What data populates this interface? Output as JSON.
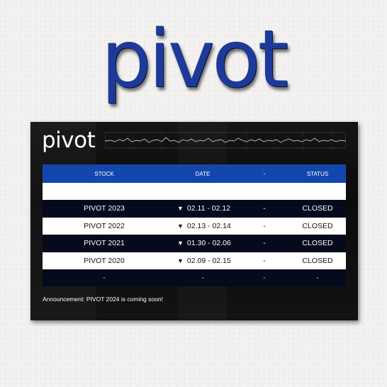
{
  "brand": {
    "logo_text": "pivot",
    "panel_logo_text": "pivot"
  },
  "table": {
    "headers": [
      "STOCK",
      "DATE",
      "-",
      "STATUS"
    ],
    "rows": [
      {
        "stock": "PIVOT 2023",
        "date": "02.11 - 02.12",
        "extra": "-",
        "status": "CLOSED"
      },
      {
        "stock": "PIVOT 2022",
        "date": "02.13 - 02.14",
        "extra": "-",
        "status": "CLOSED"
      },
      {
        "stock": "PIVOT 2021",
        "date": "01.30 - 02.06",
        "extra": "-",
        "status": "CLOSED"
      },
      {
        "stock": "PIVOT 2020",
        "date": "02.09 - 02.15",
        "extra": "-",
        "status": "CLOSED"
      }
    ],
    "empty_row": [
      "-",
      "-",
      "-",
      "-"
    ],
    "triangle": "▼"
  },
  "announcement": "Announcement: PIVOT 2024 is coming soon!",
  "colors": {
    "accent": "#1447ad",
    "dark_row": "#050a1c",
    "logo": "#1d3a9a"
  }
}
